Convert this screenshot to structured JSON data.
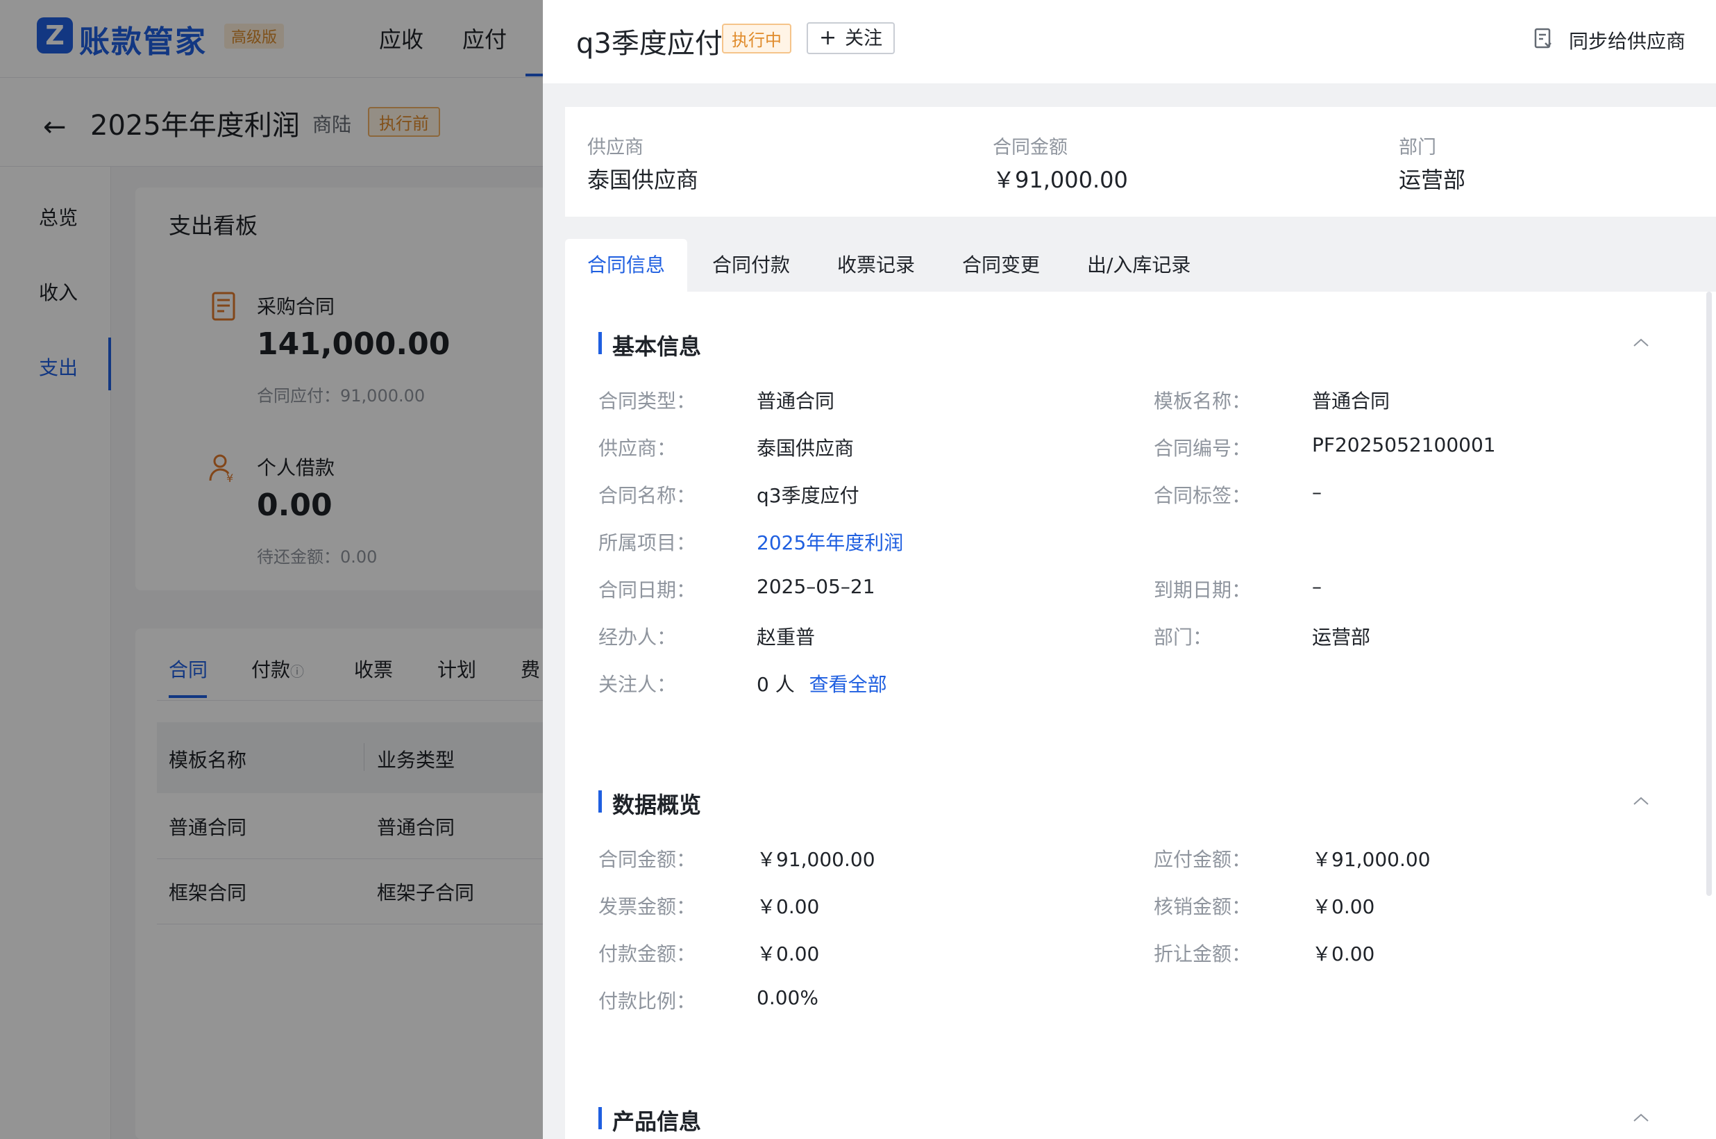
{
  "app": {
    "logo_letter": "Z",
    "name": "账款管家",
    "edition": "高级版",
    "top_nav": [
      "应收",
      "应付"
    ]
  },
  "project": {
    "title": "2025年年度利润",
    "owner": "商陆",
    "status": "执行前"
  },
  "left_nav": [
    "总览",
    "收入",
    "支出"
  ],
  "dashboard": {
    "title": "支出看板",
    "purchase": {
      "label": "采购合同",
      "value": "141,000.00",
      "sub_label": "合同应付：",
      "sub_value": "91,000.00"
    },
    "loan": {
      "label": "个人借款",
      "value": "0.00",
      "sub_label": "待还金额：",
      "sub_value": "0.00"
    }
  },
  "bg_tabs": [
    "合同",
    "付款",
    "收票",
    "计划",
    "费"
  ],
  "bg_table": {
    "headers": [
      "模板名称",
      "业务类型"
    ],
    "rows": [
      [
        "普通合同",
        "普通合同"
      ],
      [
        "框架合同",
        "框架子合同"
      ]
    ]
  },
  "drawer": {
    "title": "q3季度应付",
    "status": "执行中",
    "follow_label": "关注",
    "sync_label": "同步给供应商",
    "summary": [
      {
        "label": "供应商",
        "value": "泰国供应商"
      },
      {
        "label": "合同金额",
        "value": "￥91,000.00"
      },
      {
        "label": "部门",
        "value": "运营部"
      }
    ],
    "tabs": [
      "合同信息",
      "合同付款",
      "收票记录",
      "合同变更",
      "出/入库记录"
    ],
    "basic": {
      "title": "基本信息",
      "contract_type_label": "合同类型：",
      "contract_type": "普通合同",
      "template_label": "模板名称：",
      "template": "普通合同",
      "supplier_label": "供应商：",
      "supplier": "泰国供应商",
      "number_label": "合同编号：",
      "number": "PF2025052100001",
      "name_label": "合同名称：",
      "name": "q3季度应付",
      "tag_label": "合同标签：",
      "tag": "–",
      "project_label": "所属项目：",
      "project": "2025年年度利润",
      "date_label": "合同日期：",
      "date": "2025–05–21",
      "due_label": "到期日期：",
      "due": "–",
      "handler_label": "经办人：",
      "handler": "赵重普",
      "dept_label": "部门：",
      "dept": "运营部",
      "followers_label": "关注人：",
      "followers": "0 人",
      "view_all": "查看全部"
    },
    "overview": {
      "title": "数据概览",
      "contract_amount_label": "合同金额：",
      "contract_amount": "￥91,000.00",
      "payable_label": "应付金额：",
      "payable": "￥91,000.00",
      "invoice_label": "发票金额：",
      "invoice": "￥0.00",
      "writeoff_label": "核销金额：",
      "writeoff": "￥0.00",
      "paid_label": "付款金额：",
      "paid": "￥0.00",
      "discount_label": "折让金额：",
      "discount": "￥0.00",
      "ratio_label": "付款比例：",
      "ratio": "0.00%"
    },
    "product": {
      "title": "产品信息"
    }
  }
}
